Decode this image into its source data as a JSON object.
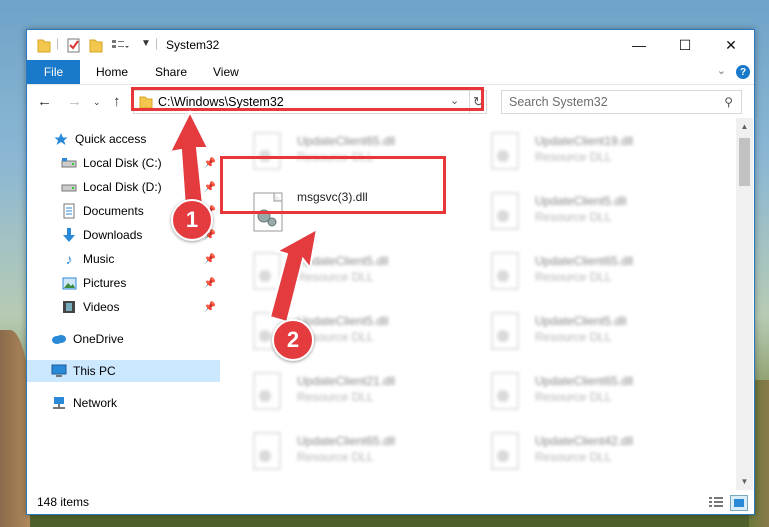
{
  "window": {
    "title": "System32",
    "controls": {
      "minimize": "—",
      "maximize": "☐",
      "close": "✕"
    }
  },
  "ribbon": {
    "tabs": [
      {
        "label": "File"
      },
      {
        "label": "Home"
      },
      {
        "label": "Share"
      },
      {
        "label": "View"
      }
    ],
    "help": "?"
  },
  "address": {
    "path": "C:\\Windows\\System32",
    "search_placeholder": "Search System32"
  },
  "sidebar": {
    "items": [
      {
        "label": "Quick access",
        "icon": "star-icon"
      },
      {
        "label": "Local Disk (C:)",
        "icon": "drive-icon",
        "pinned": true
      },
      {
        "label": "Local Disk (D:)",
        "icon": "drive-icon",
        "pinned": true
      },
      {
        "label": "Documents",
        "icon": "documents-icon",
        "pinned": true
      },
      {
        "label": "Downloads",
        "icon": "downloads-icon",
        "pinned": true
      },
      {
        "label": "Music",
        "icon": "music-icon",
        "pinned": true
      },
      {
        "label": "Pictures",
        "icon": "pictures-icon",
        "pinned": true
      },
      {
        "label": "Videos",
        "icon": "videos-icon",
        "pinned": true
      },
      {
        "label": "OneDrive",
        "icon": "cloud-icon"
      },
      {
        "label": "This PC",
        "icon": "computer-icon",
        "selected": true
      },
      {
        "label": "Network",
        "icon": "network-icon"
      }
    ]
  },
  "files": {
    "highlighted": {
      "name": "msgsvc(3).dll"
    },
    "left_column": [
      {
        "name": "UpdateClient65.dll",
        "type": "Resource DLL"
      },
      {
        "name": "UpdateClient5.dll",
        "type": "Resource DLL"
      },
      {
        "name": "UpdateClient5.dll",
        "type": "Resource DLL"
      },
      {
        "name": "UpdateClient21.dll",
        "type": "Resource DLL"
      },
      {
        "name": "UpdateClient65.dll",
        "type": "Resource DLL"
      }
    ],
    "right_column": [
      {
        "name": "UpdateClient19.dll",
        "type": "Resource DLL"
      },
      {
        "name": "UpdateClient5.dll",
        "type": "Resource DLL"
      },
      {
        "name": "UpdateClient65.dll",
        "type": "Resource DLL"
      },
      {
        "name": "UpdateClient5.dll",
        "type": "Resource DLL"
      },
      {
        "name": "UpdateClient65.dll",
        "type": "Resource DLL"
      },
      {
        "name": "UpdateClient42.dll",
        "type": "Resource DLL"
      }
    ]
  },
  "status": {
    "item_count": "148 items"
  },
  "annotations": {
    "step1": "1",
    "step2": "2"
  },
  "colors": {
    "accent": "#1979ca",
    "highlight": "#e8363b",
    "selected": "#cce8ff"
  }
}
